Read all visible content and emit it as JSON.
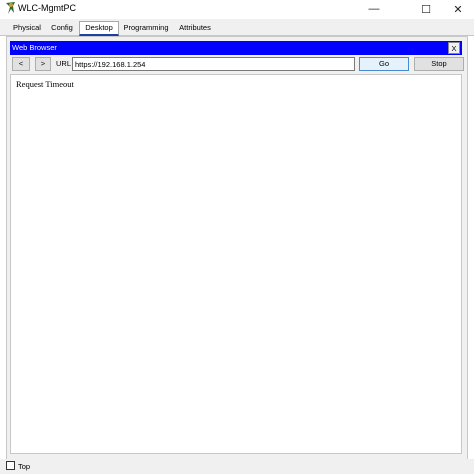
{
  "window": {
    "title": "WLC-MgmtPC",
    "minimize_glyph": "—",
    "maximize_glyph": "☐",
    "close_glyph": "✕"
  },
  "tabs": [
    {
      "label": "Physical"
    },
    {
      "label": "Config"
    },
    {
      "label": "Desktop",
      "active": true
    },
    {
      "label": "Programming"
    },
    {
      "label": "Attributes"
    }
  ],
  "browser": {
    "title": "Web Browser",
    "close_label": "X",
    "back_label": "<",
    "forward_label": ">",
    "url_label": "URL",
    "url_value": "https://192.168.1.254",
    "go_label": "Go",
    "stop_label": "Stop",
    "content_message": "Request Timeout",
    "title_bar_color": "#0000ff"
  },
  "footer": {
    "top_checkbox_label": "Top",
    "top_checked": false
  },
  "icons": {
    "app": "packet-tracer-pc-icon"
  }
}
